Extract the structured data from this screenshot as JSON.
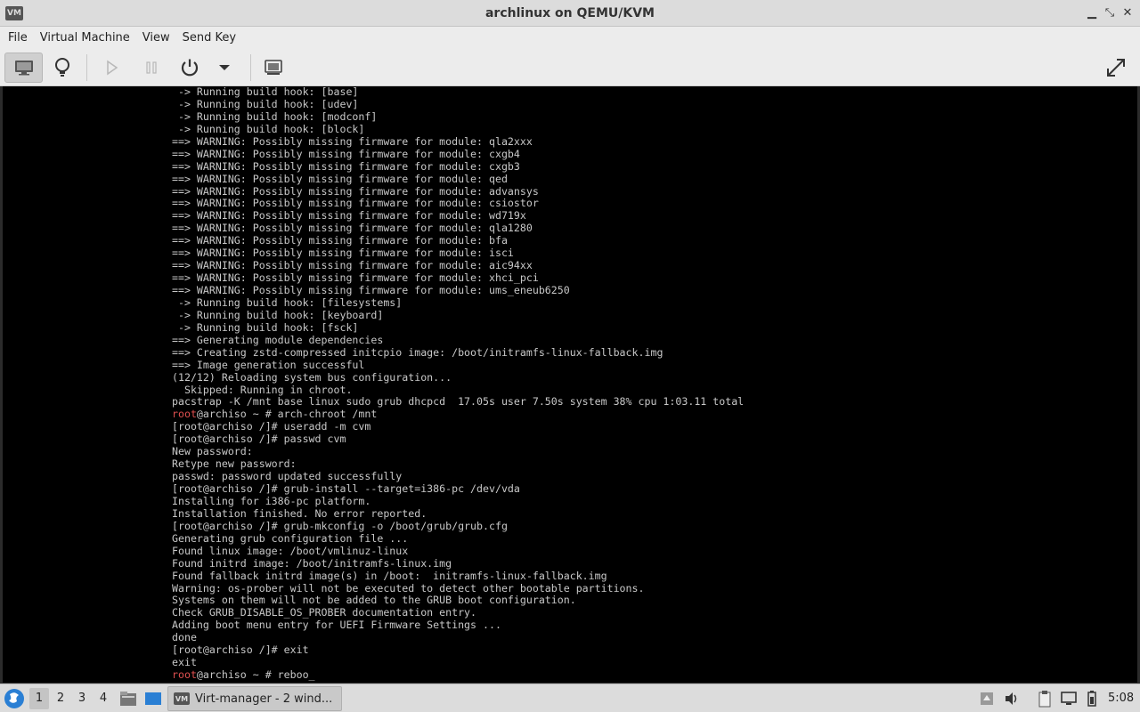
{
  "window": {
    "title": "archlinux on QEMU/KVM",
    "app_icon_text": "VM"
  },
  "menubar": {
    "items": [
      "File",
      "Virtual Machine",
      "View",
      "Send Key"
    ]
  },
  "console": {
    "lines": [
      " -> Running build hook: [base]",
      " -> Running build hook: [udev]",
      " -> Running build hook: [modconf]",
      " -> Running build hook: [block]",
      "==> WARNING: Possibly missing firmware for module: qla2xxx",
      "==> WARNING: Possibly missing firmware for module: cxgb4",
      "==> WARNING: Possibly missing firmware for module: cxgb3",
      "==> WARNING: Possibly missing firmware for module: qed",
      "==> WARNING: Possibly missing firmware for module: advansys",
      "==> WARNING: Possibly missing firmware for module: csiostor",
      "==> WARNING: Possibly missing firmware for module: wd719x",
      "==> WARNING: Possibly missing firmware for module: qla1280",
      "==> WARNING: Possibly missing firmware for module: bfa",
      "==> WARNING: Possibly missing firmware for module: isci",
      "==> WARNING: Possibly missing firmware for module: aic94xx",
      "==> WARNING: Possibly missing firmware for module: xhci_pci",
      "==> WARNING: Possibly missing firmware for module: ums_eneub6250",
      " -> Running build hook: [filesystems]",
      " -> Running build hook: [keyboard]",
      " -> Running build hook: [fsck]",
      "==> Generating module dependencies",
      "==> Creating zstd-compressed initcpio image: /boot/initramfs-linux-fallback.img",
      "==> Image generation successful",
      "(12/12) Reloading system bus configuration...",
      "  Skipped: Running in chroot.",
      "pacstrap -K /mnt base linux sudo grub dhcpcd  17.05s user 7.50s system 38% cpu 1:03.11 total",
      "root@archiso ~ # arch-chroot /mnt",
      "[root@archiso /]# useradd -m cvm",
      "[root@archiso /]# passwd cvm",
      "New password:",
      "Retype new password:",
      "passwd: password updated successfully",
      "[root@archiso /]# grub-install --target=i386-pc /dev/vda",
      "Installing for i386-pc platform.",
      "Installation finished. No error reported.",
      "[root@archiso /]# grub-mkconfig -o /boot/grub/grub.cfg",
      "Generating grub configuration file ...",
      "Found linux image: /boot/vmlinuz-linux",
      "Found initrd image: /boot/initramfs-linux.img",
      "Found fallback initrd image(s) in /boot:  initramfs-linux-fallback.img",
      "Warning: os-prober will not be executed to detect other bootable partitions.",
      "Systems on them will not be added to the GRUB boot configuration.",
      "Check GRUB_DISABLE_OS_PROBER documentation entry.",
      "Adding boot menu entry for UEFI Firmware Settings ...",
      "done",
      "[root@archiso /]# exit",
      "exit",
      "root@archiso ~ # reboo_"
    ],
    "prompt_user": "root"
  },
  "taskbar": {
    "workspaces": [
      "1",
      "2",
      "3",
      "4"
    ],
    "active_workspace": "1",
    "task_label": "Virt-manager - 2 wind...",
    "clock": "5:08"
  },
  "colors": {
    "prompt_red": "#e05050",
    "console_text": "#c8c8c8",
    "console_bg": "#000000"
  }
}
